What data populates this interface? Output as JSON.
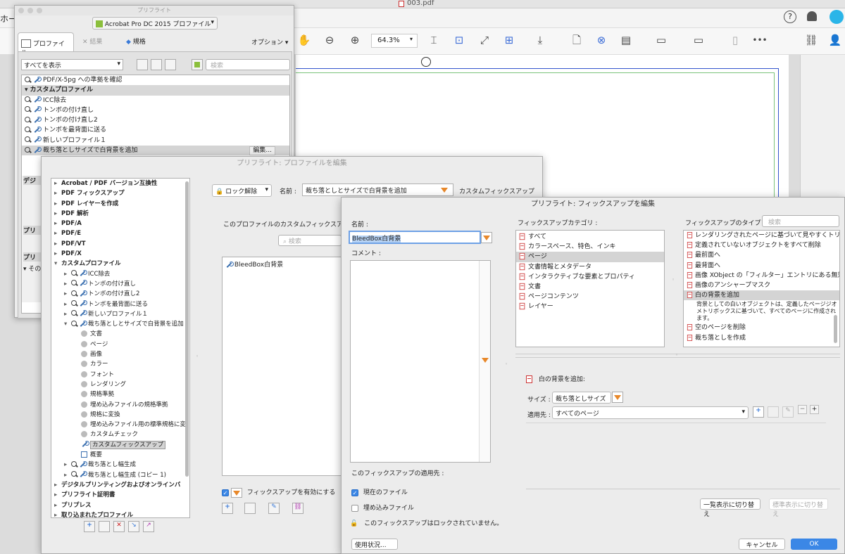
{
  "top_bar": {
    "filename": "003.pdf",
    "home_fragment": "ホー"
  },
  "toolbar": {
    "zoom": "64.3%",
    "icons": [
      "hand-icon",
      "zoom-out-icon",
      "zoom-in-icon",
      "crop-icon",
      "fit-icon",
      "expand-icon",
      "layout-icon",
      "download-icon",
      "add-page-icon",
      "preflight-icon",
      "pages-icon",
      "measure-icon",
      "compare-icon",
      "document-icon",
      "more-icon",
      "share-icon",
      "add-user-icon"
    ],
    "more": "•••"
  },
  "preflight": {
    "title": "プリフライト",
    "profile_selector": "Acrobat Pro DC 2015 プロファイル",
    "tabs": [
      "プロファイル",
      "結果",
      "規格"
    ],
    "options": "オプション",
    "filter": "すべてを表示",
    "search_placeholder": "検索",
    "rows": [
      {
        "label": "PDF/X-5pg への準拠を確認",
        "kind": "item"
      },
      {
        "label": "カスタムプロファイル",
        "kind": "group"
      },
      {
        "label": "ICC除去",
        "kind": "item"
      },
      {
        "label": "トンボの付け直し",
        "kind": "item"
      },
      {
        "label": "トンボの付け直し2",
        "kind": "item"
      },
      {
        "label": "トンボを最背面に送る",
        "kind": "item"
      },
      {
        "label": "新しいプロファイル１",
        "kind": "item"
      },
      {
        "label": "裁ち落としサイズで白背景を追加",
        "kind": "selected"
      }
    ],
    "edit_button": "編集...",
    "partial_labels": [
      "デジ",
      "プリ",
      "プリ"
    ],
    "bottom_fragment": "その他"
  },
  "profile_editor": {
    "title": "プリフライト: プロファイルを編集",
    "tree": [
      {
        "label": "Acrobat / PDF バージョン互換性",
        "level": 0,
        "bold": true,
        "icons": 0
      },
      {
        "label": "PDF フィックスアップ",
        "level": 0,
        "bold": true,
        "icons": 0
      },
      {
        "label": "PDF レイヤーを作成",
        "level": 0,
        "bold": true,
        "icons": 0
      },
      {
        "label": "PDF 解析",
        "level": 0,
        "bold": true,
        "icons": 0
      },
      {
        "label": "PDF/A",
        "level": 0,
        "bold": true,
        "icons": 0
      },
      {
        "label": "PDF/E",
        "level": 0,
        "bold": true,
        "icons": 0
      },
      {
        "label": "PDF/VT",
        "level": 0,
        "bold": true,
        "icons": 0
      },
      {
        "label": "PDF/X",
        "level": 0,
        "bold": true,
        "icons": 0
      },
      {
        "label": "カスタムプロファイル",
        "level": 0,
        "bold": true,
        "open": true,
        "icons": 0
      },
      {
        "label": "ICC除去",
        "level": 1,
        "icons": 2
      },
      {
        "label": "トンボの付け直し",
        "level": 1,
        "icons": 2
      },
      {
        "label": "トンボの付け直し2",
        "level": 1,
        "icons": 2
      },
      {
        "label": "トンボを最背面に送る",
        "level": 1,
        "icons": 2
      },
      {
        "label": "新しいプロファイル１",
        "level": 1,
        "icons": 2
      },
      {
        "label": "裁ち落としとサイズで白背景を追加",
        "level": 1,
        "open": true,
        "icons": 2
      },
      {
        "label": "文書",
        "level": 2,
        "icons": 1
      },
      {
        "label": "ページ",
        "level": 2,
        "icons": 1
      },
      {
        "label": "画像",
        "level": 2,
        "icons": 1
      },
      {
        "label": "カラー",
        "level": 2,
        "icons": 1
      },
      {
        "label": "フォント",
        "level": 2,
        "icons": 1
      },
      {
        "label": "レンダリング",
        "level": 2,
        "icons": 1
      },
      {
        "label": "規格準拠",
        "level": 2,
        "icons": 1
      },
      {
        "label": "埋め込みファイルの規格準拠",
        "level": 2,
        "icons": 1
      },
      {
        "label": "規格に変換",
        "level": 2,
        "icons": 1
      },
      {
        "label": "埋め込みファイル用の標準規格に変",
        "level": 2,
        "icons": 1
      },
      {
        "label": "カスタムチェック",
        "level": 2,
        "icons": 1
      },
      {
        "label": "カスタムフィックスアップ",
        "level": 2,
        "selected": true,
        "icons": 3
      },
      {
        "label": "概要",
        "level": 2,
        "icons": 4
      },
      {
        "label": "裁ち落とし幅生成",
        "level": 1,
        "icons": 2
      },
      {
        "label": "裁ち落とし幅生成 (コピー 1)",
        "level": 1,
        "icons": 2
      },
      {
        "label": "デジタルプリンティングおよびオンラインバ",
        "level": 0,
        "bold": true,
        "icons": 0
      },
      {
        "label": "プリフライト証明書",
        "level": 0,
        "bold": true,
        "icons": 0
      },
      {
        "label": "プリプレス",
        "level": 0,
        "bold": true,
        "icons": 0
      },
      {
        "label": "取り込まれたプロファイル",
        "level": 0,
        "bold": true,
        "icons": 0
      }
    ],
    "lock": "ロック解除",
    "name_label": "名前 :",
    "name_value": "裁ち落としとサイズで白背景を追加",
    "custom_fixup_heading": "カスタムフィックスアップ",
    "list_caption": "このプロファイルのカスタムフィックスアップ",
    "search_placeholder": "検索",
    "fixups": [
      "BleedBox白背景"
    ],
    "enable_label": "フィックスアップを有効にする"
  },
  "fixup_editor": {
    "title": "プリフライト: フィックスアップを編集",
    "name_label": "名前 :",
    "name_value": "BleedBox白背景",
    "comment_label": "コメント :",
    "category_label": "フィックスアップカテゴリ :",
    "categories": [
      "すべて",
      "カラースペース、特色、インキ",
      "ページ",
      "文書情報とメタデータ",
      "インタラクティブな要素とプロパティ",
      "文書",
      "ページコンテンツ",
      "レイヤー"
    ],
    "type_label": "フィックスアップのタイプ :",
    "type_search": "検索",
    "types": [
      "レンダリングされたページに基づいて見やすくトリミ",
      "定義されていないオブジェクトをすべて削除",
      "最前面へ",
      "最背面へ",
      "画像 XObject の「フィルター」エントリにある無効",
      "画像のアンシャープマスク",
      "白の背景を追加"
    ],
    "type_description": "背景としての白いオブジェクトは、定義したページジオメトリボックスに基づいて、すべてのページに作成されます。",
    "types_after": [
      "空のページを削除",
      "裁ち落としを作成"
    ],
    "param_title": "白の背景を追加:",
    "size_label": "サイズ :",
    "size_value": "裁ち落としサイズ",
    "apply_label": "適用先 :",
    "apply_value": "すべてのページ",
    "applies_to": "このフィックスアップの適用先 :",
    "current_file": "現在のファイル",
    "embedded_files": "埋め込みファイル",
    "lock_text": "このフィックスアップはロックされていません。",
    "list_view": "一覧表示に切り替え",
    "standard_view": "標準表示に切り替え",
    "usage": "使用状況...",
    "cancel": "キャンセル",
    "ok": "OK"
  }
}
